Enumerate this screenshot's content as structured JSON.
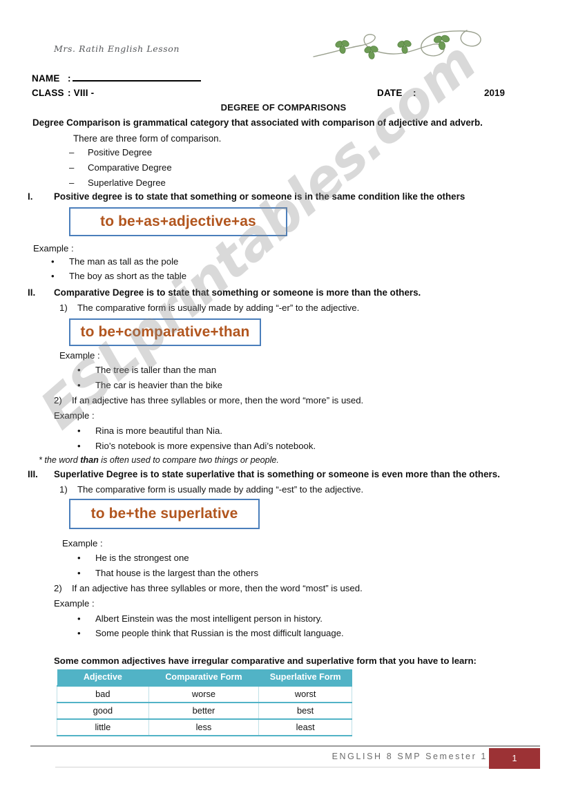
{
  "header": {
    "handwriting_note": "Mrs. Ratih English Lesson",
    "name_label": "NAME",
    "name_colon": ":",
    "class_label": "CLASS",
    "class_value": ": VIII -",
    "date_label": "DATE",
    "date_colon": ":",
    "year": "2019",
    "decoration": "shamrock-vine"
  },
  "document": {
    "title": "DEGREE OF COMPARISONS",
    "lead": "Degree Comparison is grammatical category that associated with comparison of adjective and adverb.",
    "intro": "There are three form of comparison.",
    "forms": [
      {
        "dash": "–",
        "label": "Positive Degree"
      },
      {
        "dash": "–",
        "label": "Comparative Degree"
      },
      {
        "dash": "–",
        "label": "Superlative Degree"
      }
    ]
  },
  "sections": [
    {
      "numeral": "I.",
      "heading": "Positive degree is to state that something or someone is in the same condition like the others",
      "formula": "to be+as+adjective+as",
      "example_label": "Example :",
      "examples": [
        "The man as tall as the pole",
        "The boy as short as the table"
      ]
    },
    {
      "numeral": "II.",
      "heading": "Comparative Degree is to state that something or someone is more than the others.",
      "rule1_num": "1)",
      "rule1": "The comparative form is usually made by adding “-er” to the adjective.",
      "formula": "to be+comparative+than",
      "example_label_1": "Example :",
      "examples_1": [
        "The tree is taller than the man",
        "The car is heavier than the bike"
      ],
      "rule2_num": "2)",
      "rule2": "If an adjective has three syllables or more, then the word “more” is used.",
      "example_label_2": "Example :",
      "examples_2": [
        "Rina is more beautiful than Nia.",
        "Rio’s notebook is more expensive than Adi’s notebook."
      ],
      "note_prefix": "* the word ",
      "note_bold": "than",
      "note_suffix": " is often used to compare two things or people."
    },
    {
      "numeral": "III.",
      "heading": "Superlative Degree is to state superlative that is something or someone is even more than the others.",
      "rule1_num": "1)",
      "rule1": "The comparative form is usually made by adding “-est” to the adjective.",
      "formula": "to be+the superlative",
      "example_label_1": "Example :",
      "examples_1": [
        "He is the strongest one",
        "That house is the largest than the others"
      ],
      "rule2_num": "2)",
      "rule2": "If an adjective has three syllables or more, then the word “most” is used.",
      "example_label_2": "Example :",
      "examples_2": [
        "Albert Einstein was the most intelligent person in history.",
        "Some people think that Russian is the most difficult language."
      ]
    }
  ],
  "table": {
    "caption": "Some common adjectives have irregular comparative and superlative form that you have to learn:",
    "columns": [
      "Adjective",
      "Comparative Form",
      "Superlative Form"
    ],
    "rows": [
      [
        "bad",
        "worse",
        "worst"
      ],
      [
        "good",
        "better",
        "best"
      ],
      [
        "little",
        "less",
        "least"
      ]
    ]
  },
  "footer": {
    "text": "ENGLISH 8 SMP Semester 1",
    "page_number": "1"
  },
  "watermark": {
    "text": "ESLprintables.com"
  },
  "colors": {
    "formula_border": "#4a7ebb",
    "formula_text": "#b1551e",
    "table_header": "#51b3c6",
    "page_badge": "#9c3235",
    "footer_text": "#6b6b6b"
  },
  "bullets": {
    "dot": "•"
  }
}
